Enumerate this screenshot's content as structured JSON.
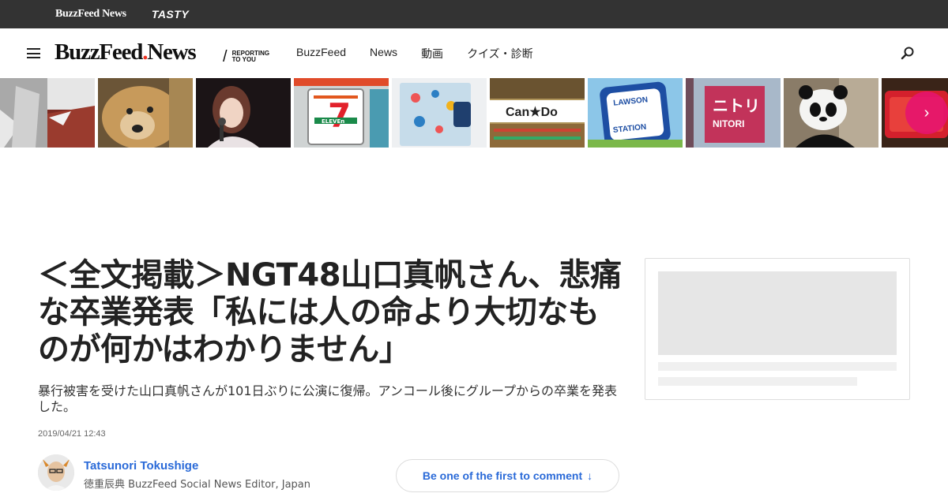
{
  "topbar": {
    "brand": "BuzzFeed News",
    "tasty": "TASTY"
  },
  "nav": {
    "logo_main": "BuzzFeed",
    "logo_news": "News",
    "tagline": "REPORTING TO YOU",
    "links": [
      {
        "label": "BuzzFeed"
      },
      {
        "label": "News"
      },
      {
        "label": "動画"
      },
      {
        "label": "クイズ・診断"
      }
    ],
    "icons": {
      "menu": "hamburger-menu-icon",
      "search": "search-icon"
    }
  },
  "thumbnails": [
    {
      "name": "thumb-storefront-flooded"
    },
    {
      "name": "thumb-dog"
    },
    {
      "name": "thumb-idol-microphone"
    },
    {
      "name": "thumb-seven-eleven",
      "text": "ELEVEn"
    },
    {
      "name": "thumb-notebook"
    },
    {
      "name": "thumb-cando",
      "text": "Can★Do"
    },
    {
      "name": "thumb-lawson",
      "text": "LAWSON STATION"
    },
    {
      "name": "thumb-nitori",
      "text": "ニトリ NITORI"
    },
    {
      "name": "thumb-panda"
    },
    {
      "name": "thumb-red-sign"
    }
  ],
  "article": {
    "headline": "＜全文掲載＞NGT48山口真帆さん、悲痛な卒業発表「私には人の命より大切なものが何かはわかりません」",
    "dek": "暴行被害を受けた山口真帆さんが101日ぶりに公演に復帰。アンコール後にグループからの卒業を発表した。",
    "date": "2019/04/21 12:43",
    "author_name": "Tatsunori Tokushige",
    "author_role": "徳重辰典 BuzzFeed Social News Editor, Japan",
    "comment_label": "Be one of the first to comment",
    "comment_arrow": "↓"
  },
  "colors": {
    "topbar_bg": "#333333",
    "link_blue": "#2a6ad8",
    "logo_dot": "#ee3322",
    "next_button": "#e6146e"
  }
}
